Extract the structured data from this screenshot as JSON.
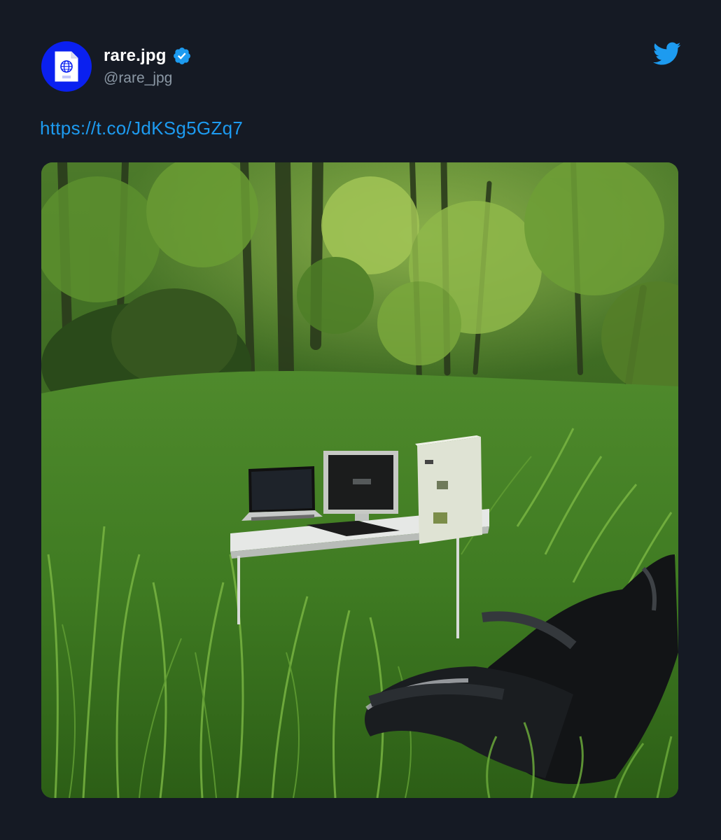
{
  "tweet": {
    "author": {
      "name": "rare.jpg",
      "handle": "@rare_jpg",
      "verified": true,
      "avatar_icon": "jpg-file-globe-icon",
      "avatar_color": "#0a20f0"
    },
    "link": "https://t.co/JdKSg5GZq7",
    "media": {
      "alt": ""
    },
    "brand_icon": "twitter-bird-icon"
  },
  "colors": {
    "background": "#151a24",
    "link": "#1d9bf0",
    "handle": "#8b98a5",
    "verified_badge": "#1d9bf0",
    "twitter_blue": "#1d9bf0"
  }
}
